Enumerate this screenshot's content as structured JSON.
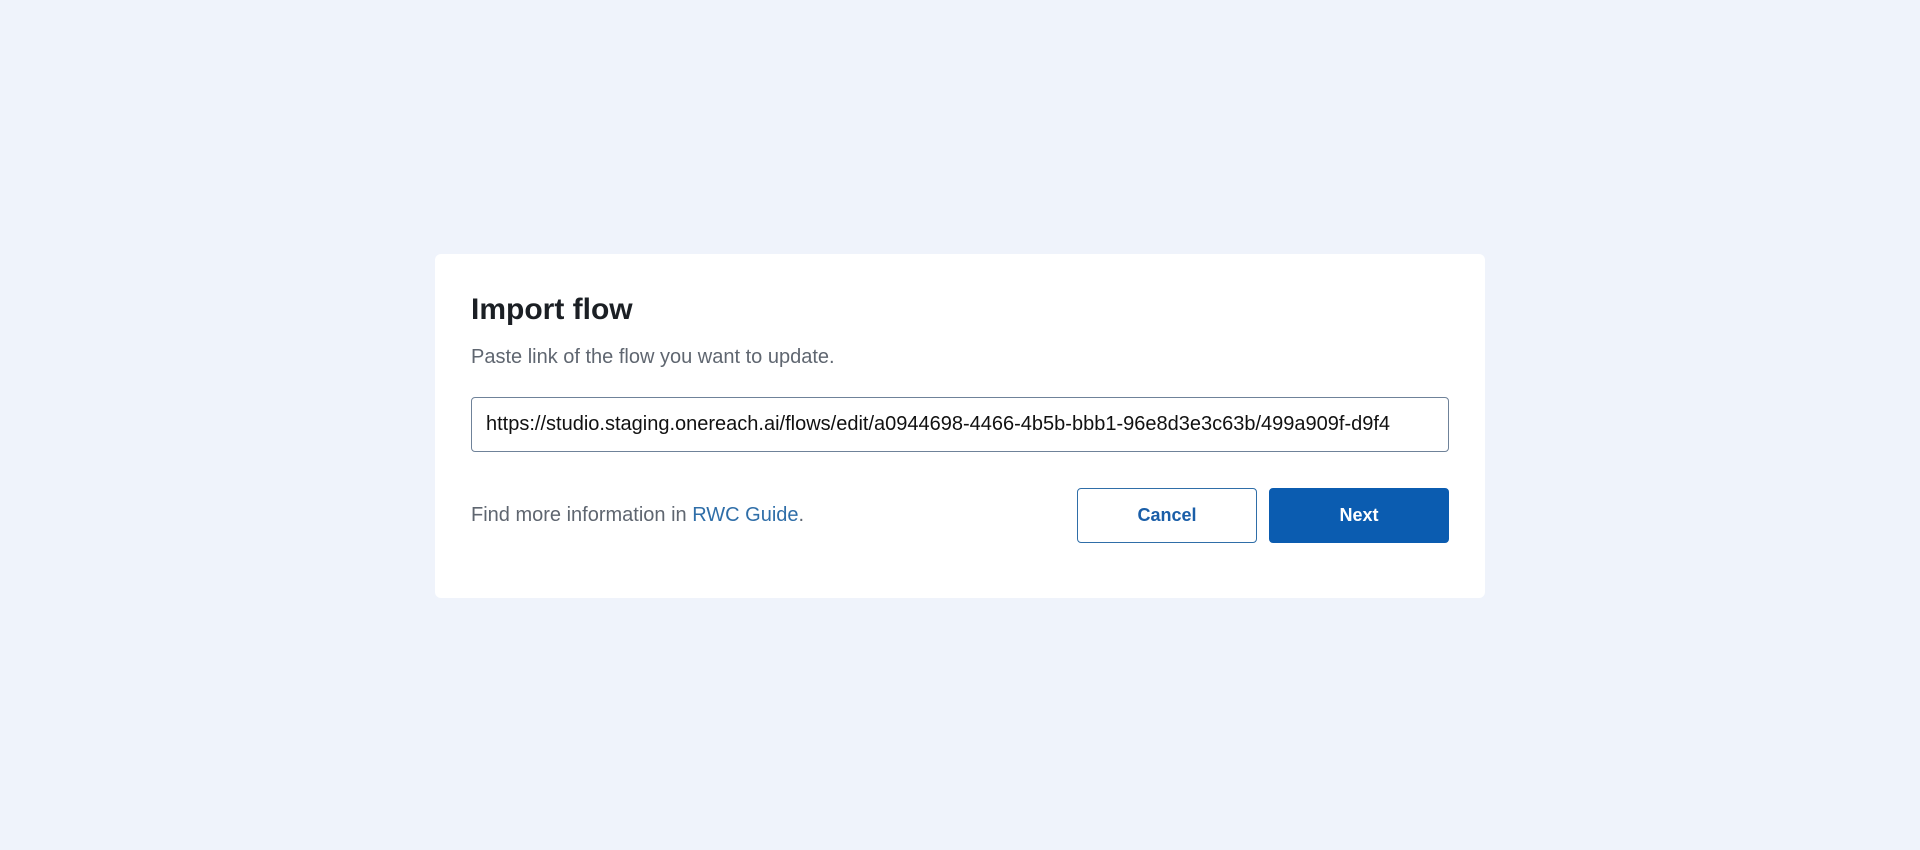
{
  "dialog": {
    "title": "Import flow",
    "subtitle": "Paste link of the flow you want to update.",
    "url_value": "https://studio.staging.onereach.ai/flows/edit/a0944698-4466-4b5b-bbb1-96e8d3e3c63b/499a909f-d9f4",
    "info_prefix": "Find more information in ",
    "info_link": "RWC Guide",
    "info_suffix": ".",
    "cancel_label": "Cancel",
    "next_label": "Next"
  },
  "colors": {
    "background": "#eff3fb",
    "primary": "#0b5cb0",
    "link": "#2f6ea8"
  }
}
